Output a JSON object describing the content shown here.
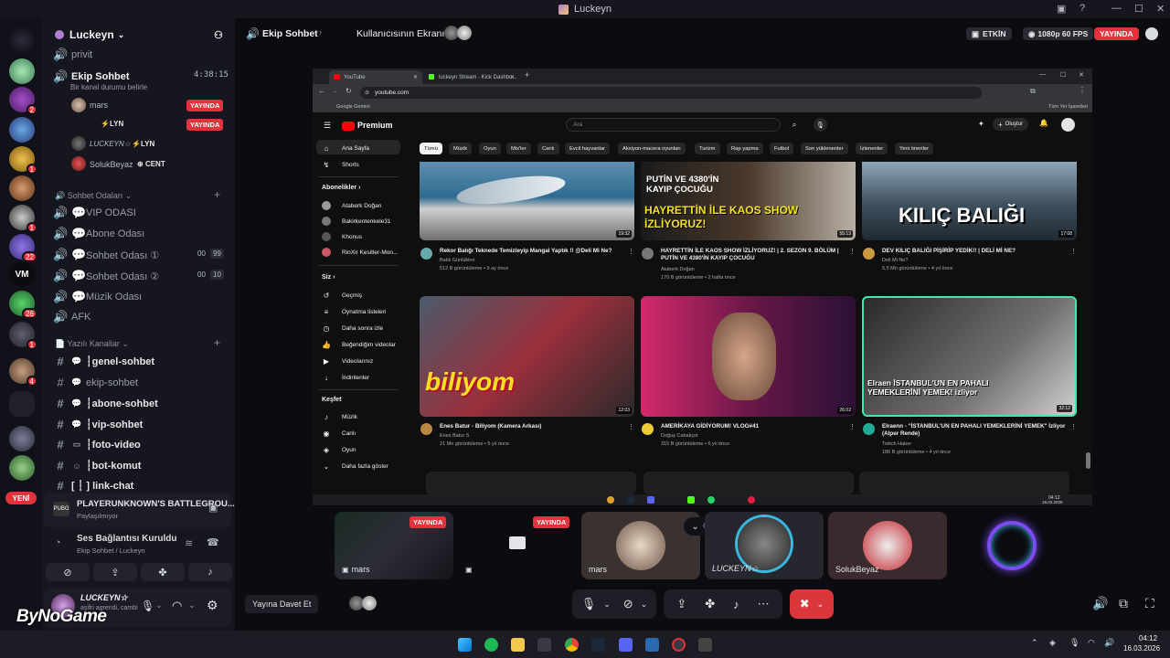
{
  "window": {
    "title": "Luckeyn"
  },
  "server_rail": {
    "badges": [
      "2",
      "1",
      "1",
      "22",
      "26",
      "1",
      "4"
    ],
    "new_label": "YENİ"
  },
  "sidebar": {
    "guild_name": "Luckeyn",
    "channels_top": [
      {
        "name": "privit"
      }
    ],
    "active_voice": {
      "name": "Ekip Sohbet",
      "timer": "4:38:15",
      "status_hint": "Bir kanal durumu belirle"
    },
    "voice_users": [
      {
        "name": "mars",
        "badge": "YAYINDA",
        "tag": ""
      },
      {
        "name": "",
        "badge": "YAYINDA",
        "tag": "LYN"
      },
      {
        "name": "LUCKEYN☆",
        "badge": "",
        "tag": "LYN"
      },
      {
        "name": "SolukBeyaz",
        "badge": "",
        "tag": "CENT"
      }
    ],
    "voice_category": "Sohbet Odaları",
    "voice_rooms": [
      {
        "name": "VIP ODASI",
        "count_a": "",
        "count_b": ""
      },
      {
        "name": "Abone Odası",
        "count_a": "",
        "count_b": ""
      },
      {
        "name": "Sohbet Odası ①",
        "count_a": "00",
        "count_b": "99"
      },
      {
        "name": "Sohbet Odası ②",
        "count_a": "00",
        "count_b": "10"
      },
      {
        "name": "Müzik Odası",
        "count_a": "",
        "count_b": ""
      },
      {
        "name": "AFK",
        "count_a": "",
        "count_b": ""
      }
    ],
    "text_category": "Yazılı Kanallar",
    "text_channels": [
      {
        "name": "┆genel-sohbet"
      },
      {
        "name": "ekip-sohbet"
      },
      {
        "name": "┆abone-sohbet"
      },
      {
        "name": "┆vip-sohbet"
      },
      {
        "name": "┆foto-video"
      },
      {
        "name": "┆bot-komut"
      },
      {
        "name": "[ ┆ ] link-chat"
      }
    ],
    "game": {
      "title": "PLAYERUNKNOWN'S BATTLEGROU...",
      "subtitle": "Paylaşılmıyor"
    },
    "voice_status": {
      "title": "Ses Bağlantısı Kuruldu",
      "subtitle": "Ekip Sohbet / Luckeyn"
    },
    "user": {
      "name": "LUCKEYN☆",
      "status": "aşifri agrendi, cambi"
    }
  },
  "topbar": {
    "channel": "Ekip Sohbet",
    "screen_title": "Kullanıcısının Ekranı",
    "active_label": "ETKİN",
    "quality": "1080p 60 FPS",
    "live_label": "YAYINDA"
  },
  "browser": {
    "tabs": [
      "YouTube",
      "luckeyn Stream - Kick Dashbo..."
    ],
    "url": "youtube.com",
    "bookmark": "Google Gemini",
    "bookmarks_right": "Tüm Yer İşaretleri"
  },
  "youtube": {
    "logo": "Premium",
    "search_placeholder": "Ara",
    "create_label": "Oluştur",
    "nav_main": [
      "Ana Sayfa",
      "Shorts"
    ],
    "subs_title": "Abonelikler",
    "subs": [
      "Ataberk Doğan",
      "Bakirkentenkele31",
      "Khonus",
      "RinXir Kesitler-Mon..."
    ],
    "you_title": "Siz",
    "you_items": [
      "Geçmiş",
      "Oynatma listeleri",
      "Daha sonra izle",
      "Beğendiğim videolar",
      "Videolarınız",
      "İndirilenler"
    ],
    "explore_title": "Keşfet",
    "explore_items": [
      "Müzik",
      "Canlı",
      "Oyun",
      "Daha fazla göster"
    ],
    "chips": [
      "Tümü",
      "Müzik",
      "Oyun",
      "Mix'ler",
      "Canlı",
      "Evcil hayvanlar",
      "Aksiyon-macera oyunları",
      "Turizm",
      "Rap yapma",
      "Futbol",
      "Son yüklenenler",
      "İzlenenler",
      "Yeni öneriler"
    ],
    "videos": [
      {
        "title": "Rekor Balığı Teknede Temizleyip Mangal Yaptık !! @Deli Mi Ne?",
        "channel": "Balık Günlükleri",
        "meta": "512 B görüntüleme • 9 ay önce",
        "duration": "19:32",
        "overlay": "",
        "overlay2": ""
      },
      {
        "title": "HAYRETTİN İLE KAOS SHOW İZLİYORUZ! | 2. SEZON 9. BÖLÜM | PUTİN VE 4380'İN KAYIP ÇOCUĞU",
        "channel": "Ataberk Doğan",
        "meta": "170 B görüntüleme • 2 hafta önce",
        "duration": "55:13",
        "overlay": "PUTİN VE 4380'İN KAYIP ÇOCUĞU",
        "overlay2": "HAYRETTİN İLE KAOS SHOW İZLİYORUZ!"
      },
      {
        "title": "DEV KILIÇ BALIĞI PİŞİRİP YEDİK!! | DELİ Mİ NE?",
        "channel": "Deli Mi Ne?",
        "meta": "5,5 Mn görüntüleme • 4 yıl önce",
        "duration": "17:08",
        "overlay": "KILIÇ BALIĞI",
        "overlay2": ""
      },
      {
        "title": "Enes Batur - Biliyom (Kamera Arkası)",
        "channel": "Enes Batur S",
        "meta": "21 Mn görüntüleme • 5 yıl önce",
        "duration": "12:03",
        "overlay": "biliyom",
        "overlay2": ""
      },
      {
        "title": "AMERİKAYA GİDİYORUM! VLOG#41",
        "channel": "Doğuş Cabakçor",
        "meta": "315 B görüntüleme • 6 yıl önce",
        "duration": "26:02",
        "overlay": "",
        "overlay2": ""
      },
      {
        "title": "Elraenn - \"İSTANBUL'UN EN PAHALI YEMEKLERİNİ YEMEK\" İzliyor (Alper Rende)",
        "channel": "Twitch Haber",
        "meta": "186 B görüntüleme • 4 yıl önce",
        "duration": "32:12",
        "overlay": "Elraen İSTANBUL'UN EN PAHALI YEMEKLERİNİ YEMEK! izliyor",
        "overlay2": ""
      }
    ],
    "clock_time": "04:12",
    "clock_date": "16.03.2026"
  },
  "participants": [
    {
      "name": "mars",
      "live": "YAYINDA"
    },
    {
      "name": "",
      "live": "YAYINDA"
    },
    {
      "name": "mars",
      "live": ""
    },
    {
      "name": "LUCKEYN☆",
      "live": ""
    },
    {
      "name": "SolukBeyaz",
      "live": ""
    }
  ],
  "controls": {
    "invite": "Yayına Davet Et"
  },
  "watermark": "ByNoGame",
  "taskbar": {
    "time": "04:12",
    "date": "16.03.2026"
  },
  "colors": {
    "live": "#e0333c",
    "accent": "#5865f2",
    "yt_red": "#ff0000",
    "connected": "#3ba55c"
  }
}
